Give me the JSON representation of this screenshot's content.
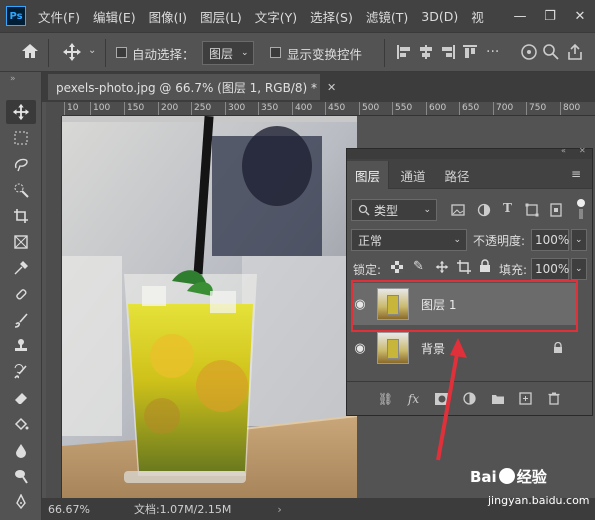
{
  "app": {
    "logo": "Ps"
  },
  "menubar": {
    "items": [
      "文件(F)",
      "编辑(E)",
      "图像(I)",
      "图层(L)",
      "文字(Y)",
      "选择(S)",
      "滤镜(T)",
      "3D(D)",
      "视"
    ],
    "window_controls": [
      "minimize-icon",
      "restore-icon",
      "close-icon"
    ]
  },
  "options": {
    "auto_select_label": "自动选择：",
    "auto_select_target": "图层",
    "show_transform_label": "显示变换控件"
  },
  "document": {
    "tab_title": "pexels-photo.jpg @ 66.7% (图层 1, RGB/8) *",
    "ruler_ticks": [
      "10",
      "100",
      "150",
      "200",
      "250",
      "300",
      "350",
      "400",
      "450",
      "500",
      "550",
      "600",
      "650",
      "700",
      "750",
      "800"
    ]
  },
  "status": {
    "zoom": "66.67%",
    "doc_info": "文档:1.07M/2.15M"
  },
  "layers_panel": {
    "tabs": [
      "图层",
      "通道",
      "路径"
    ],
    "filter_kind": "类型",
    "blend_mode": "正常",
    "opacity_label": "不透明度:",
    "opacity_value": "100%",
    "lock_label": "锁定:",
    "fill_label": "填充:",
    "fill_value": "100%",
    "layers": [
      {
        "name": "图层 1",
        "selected": true,
        "visible": true,
        "locked": false
      },
      {
        "name": "背景",
        "selected": false,
        "visible": true,
        "locked": true
      }
    ],
    "bottom_icons": [
      "link-icon",
      "fx-icon",
      "mask-icon",
      "adjustment-icon",
      "folder-icon",
      "new-layer-icon",
      "trash-icon"
    ]
  },
  "watermark": {
    "brand": "Bai",
    "brand_cn": "经验",
    "url": "jingyan.baidu.com"
  },
  "colors": {
    "annotation_red": "#e0303a",
    "selected_layer": "#6b6b6b"
  }
}
